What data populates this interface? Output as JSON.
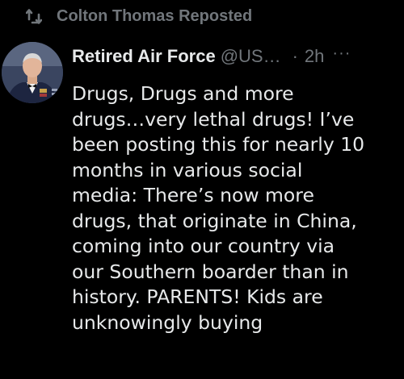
{
  "repost": {
    "icon": "repost-icon",
    "text": "Colton Thomas Reposted"
  },
  "post": {
    "avatar_icon": "user-avatar",
    "author_name": "Retired Air Force",
    "author_handle": "@US…",
    "separator": "·",
    "time": "2h",
    "more_icon": "more-icon",
    "more_glyph": "···",
    "text_lines": [
      "Drugs, Drugs and more",
      "drugs…very lethal drugs!  I’ve",
      "been posting this for nearly 10",
      "months in various social",
      "media: There’s now more",
      "drugs, that originate in China,",
      "coming into our country via",
      "our Southern boarder than in",
      "history. PARENTS! Kids are",
      "unknowingly buying"
    ]
  },
  "colors": {
    "background": "#000000",
    "primary_text": "#e7e9ea",
    "secondary_text": "#71767b"
  }
}
